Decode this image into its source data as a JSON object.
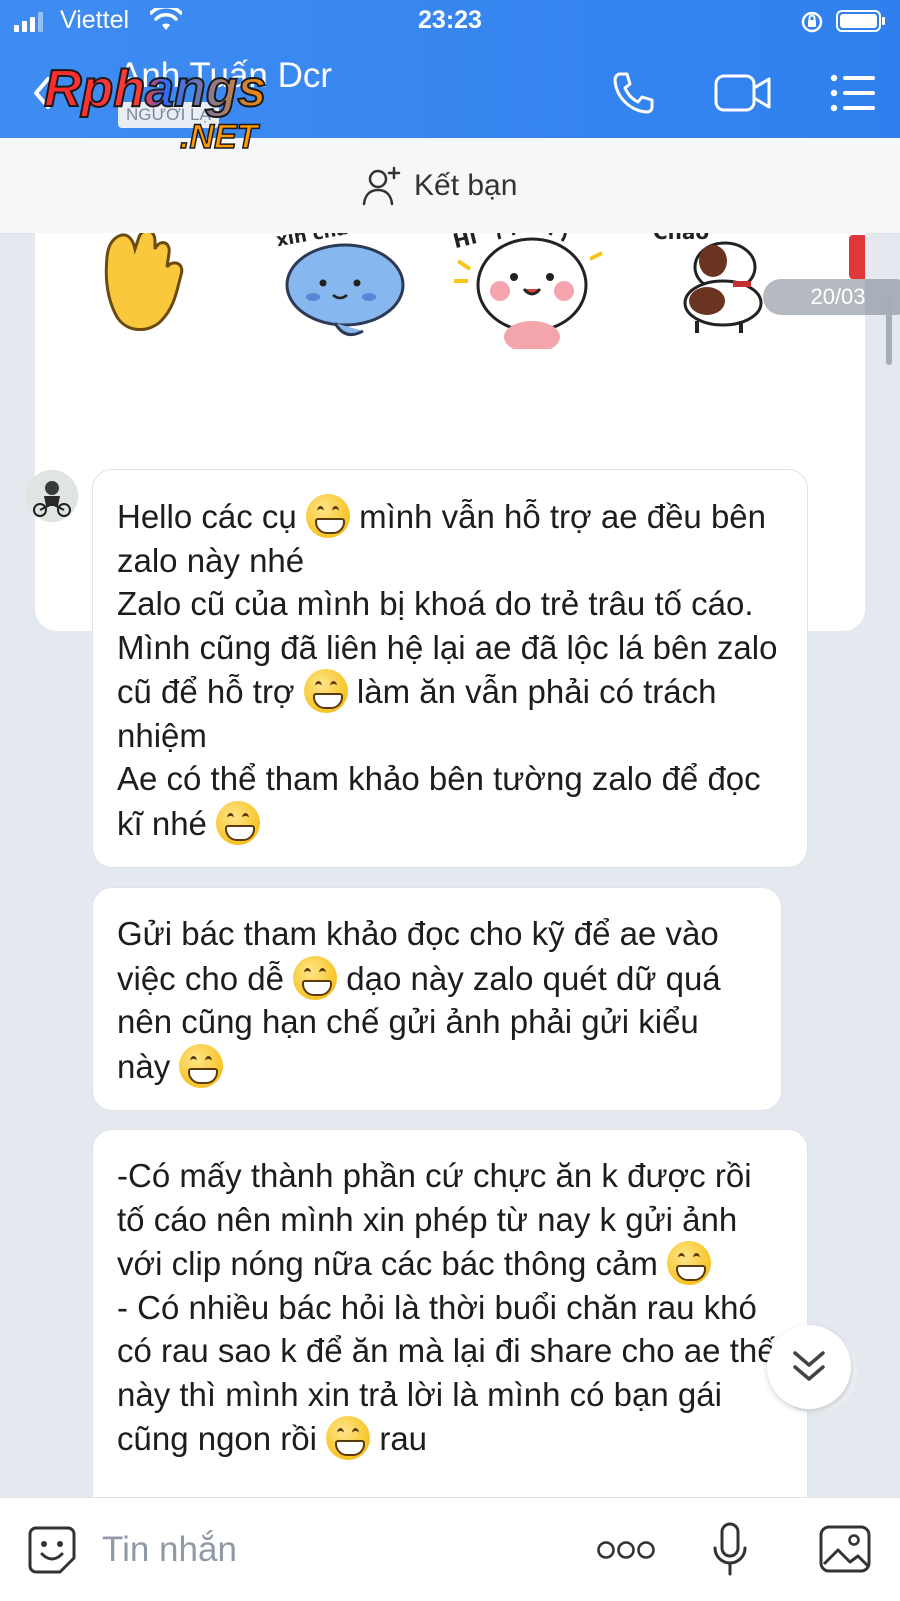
{
  "status_bar": {
    "carrier": "Viettel",
    "time": "23:23"
  },
  "header": {
    "title": "Anh Tuấn Dcr",
    "stranger_badge": "NGƯỜI LẠ",
    "watermark": "Phangs .NET",
    "icons": [
      "back-icon",
      "phone-icon",
      "video-call-icon",
      "menu-list-icon"
    ]
  },
  "friend_bar": {
    "label": "Kết bạn"
  },
  "stickers": {
    "items": [
      "waving-hand",
      "xin-chao-blue-cat",
      "hello-bunny",
      "chao-dog"
    ],
    "date": "20/03"
  },
  "messages": [
    "Hello các cụ [grin] mình vẫn hỗ trợ ae đều bên zalo này nhé\nZalo cũ của mình bị khoá do trẻ trâu tố cáo. Mình cũng đã liên hệ lại ae đã lộc lá bên zalo cũ để hỗ trợ [grin] làm ăn vẫn phải có trách nhiệm\nAe có thể tham khảo bên tường zalo để đọc kĩ nhé [grin]",
    "Gửi bác tham khảo đọc cho kỹ để ae vào việc cho dễ [grin] dạo này zalo quét dữ quá nên cũng hạn chế gửi ảnh phải gửi kiểu này [grin]",
    "-Có mấy thành phần cứ chực ăn k được rồi tố cáo nên mình xin phép từ nay k gửi ảnh với clip nóng nữa các bác thông cảm [grin]\n- Có nhiều bác hỏi là thời buổi chăn rau khó có rau sao k để ăn mà lại đi share cho ae thế này thì mình xin trả lời là mình có bạn gái cũng ngon rồi [grin] rau"
  ],
  "message_segments": {
    "m1": [
      "Hello các cụ ",
      " mình vẫn hỗ trợ ae đều bên zalo này nhé\nZalo cũ của mình bị khoá do trẻ trâu tố cáo. Mình cũng đã liên hệ lại ae đã lộc lá bên zalo cũ để hỗ trợ ",
      " làm ăn vẫn phải có trách nhiệm\nAe có thể tham khảo bên tường zalo để đọc kĩ nhé "
    ],
    "m2": [
      "Gửi bác tham khảo đọc cho kỹ để ae vào việc cho dễ ",
      " dạo này zalo quét dữ quá nên cũng hạn chế gửi ảnh phải gửi kiểu này "
    ],
    "m3": [
      "-Có mấy thành phần cứ chực ăn k được rồi tố cáo nên mình xin phép từ nay k gửi ảnh với clip nóng nữa các bác thông cảm ",
      "\n- Có nhiều bác hỏi là thời buổi chăn rau khó có rau sao k để ăn mà lại đi share cho ae thế này thì mình xin trả lời là mình có bạn gái cũng ngon rồi ",
      " rau"
    ]
  },
  "input": {
    "placeholder": "Tin nhắn"
  },
  "colors": {
    "header_blue": "#3585f0",
    "chat_bg": "#e4e8ef",
    "bubble_bg": "#ffffff"
  }
}
